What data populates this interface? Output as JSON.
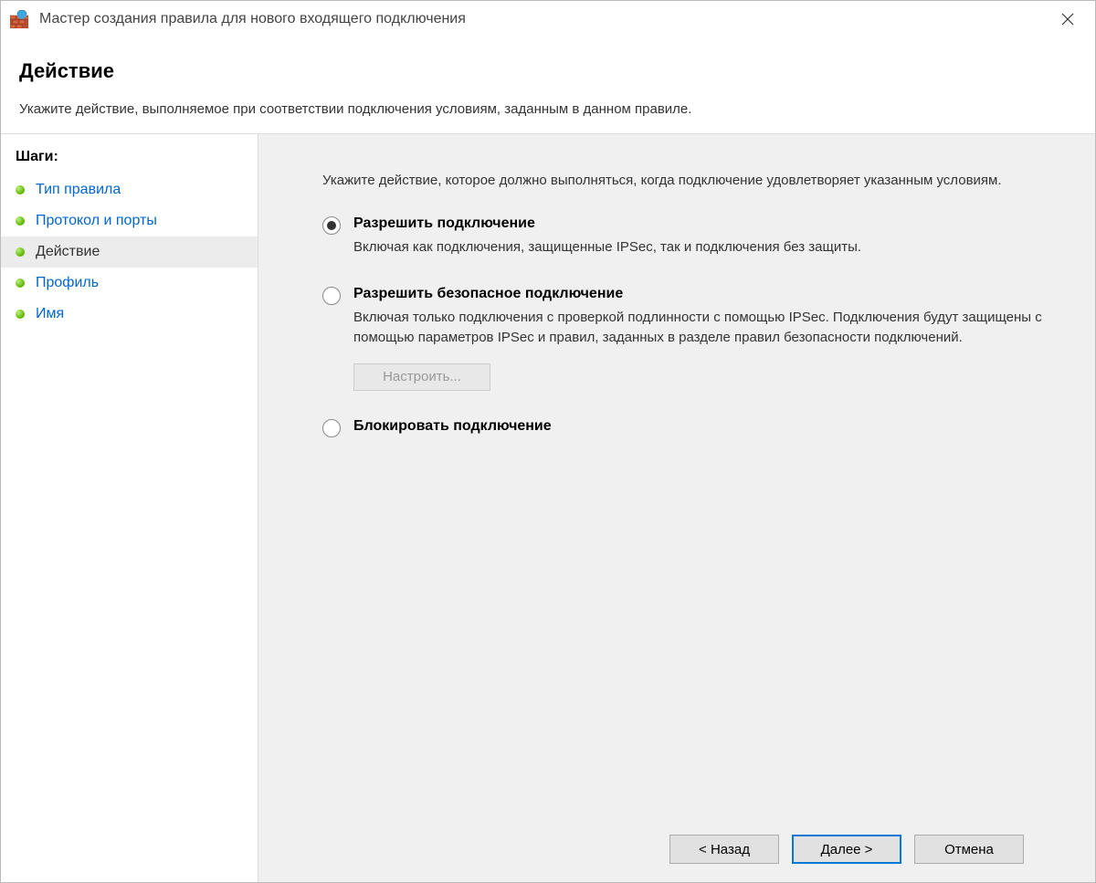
{
  "titlebar": {
    "title": "Мастер создания правила для нового входящего подключения"
  },
  "header": {
    "heading": "Действие",
    "subtitle": "Укажите действие, выполняемое при соответствии подключения условиям, заданным в данном правиле."
  },
  "sidebar": {
    "steps_label": "Шаги:",
    "items": [
      {
        "label": "Тип правила"
      },
      {
        "label": "Протокол и порты"
      },
      {
        "label": "Действие"
      },
      {
        "label": "Профиль"
      },
      {
        "label": "Имя"
      }
    ]
  },
  "main": {
    "instruction": "Укажите действие, которое должно выполняться, когда подключение удовлетворяет указанным условиям.",
    "options": [
      {
        "title": "Разрешить подключение",
        "desc": "Включая как подключения, защищенные IPSec, так и подключения без защиты."
      },
      {
        "title": "Разрешить безопасное подключение",
        "desc": "Включая только подключения с проверкой подлинности с помощью IPSec. Подключения будут защищены с помощью параметров IPSec и правил, заданных в разделе правил безопасности подключений."
      },
      {
        "title": "Блокировать подключение",
        "desc": ""
      }
    ],
    "configure_label": "Настроить..."
  },
  "footer": {
    "back": "< Назад",
    "next": "Далее >",
    "cancel": "Отмена"
  }
}
